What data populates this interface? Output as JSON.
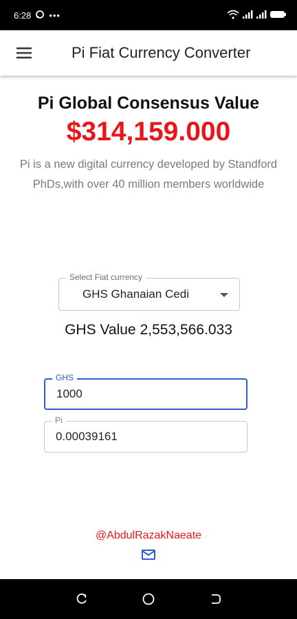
{
  "status_bar": {
    "time": "6:28",
    "dots": "•••",
    "icons": [
      "message-icon",
      "wifi-icon",
      "signal-icon",
      "signal-icon",
      "battery-icon"
    ]
  },
  "app_bar": {
    "title": "Pi Fiat Currency Converter",
    "menu_icon": "menu-icon"
  },
  "main": {
    "heading": "Pi Global Consensus Value",
    "price": "$314,159.000",
    "description": "Pi is a new digital currency developed by Standford PhDs,with over 40 million members worldwide"
  },
  "currency_select": {
    "label": "Select Fiat currency",
    "selected": "GHS Ghanaian Cedi"
  },
  "value_display": {
    "label": "GHS Value",
    "value": "2,553,566.033"
  },
  "inputs": {
    "ghs": {
      "label": "GHS",
      "value": "1000"
    },
    "pi": {
      "label": "Pi",
      "value": "0.00039161"
    }
  },
  "footer": {
    "author": "@AbdulRazakNaeate",
    "mail_icon": "mail-icon"
  },
  "nav_bar": {
    "icons": [
      "recents-icon",
      "home-icon",
      "back-icon"
    ]
  },
  "colors": {
    "accent_red": "#e8161b",
    "focus_blue": "#2f5bd3",
    "muted_text": "#7a7a7a"
  }
}
